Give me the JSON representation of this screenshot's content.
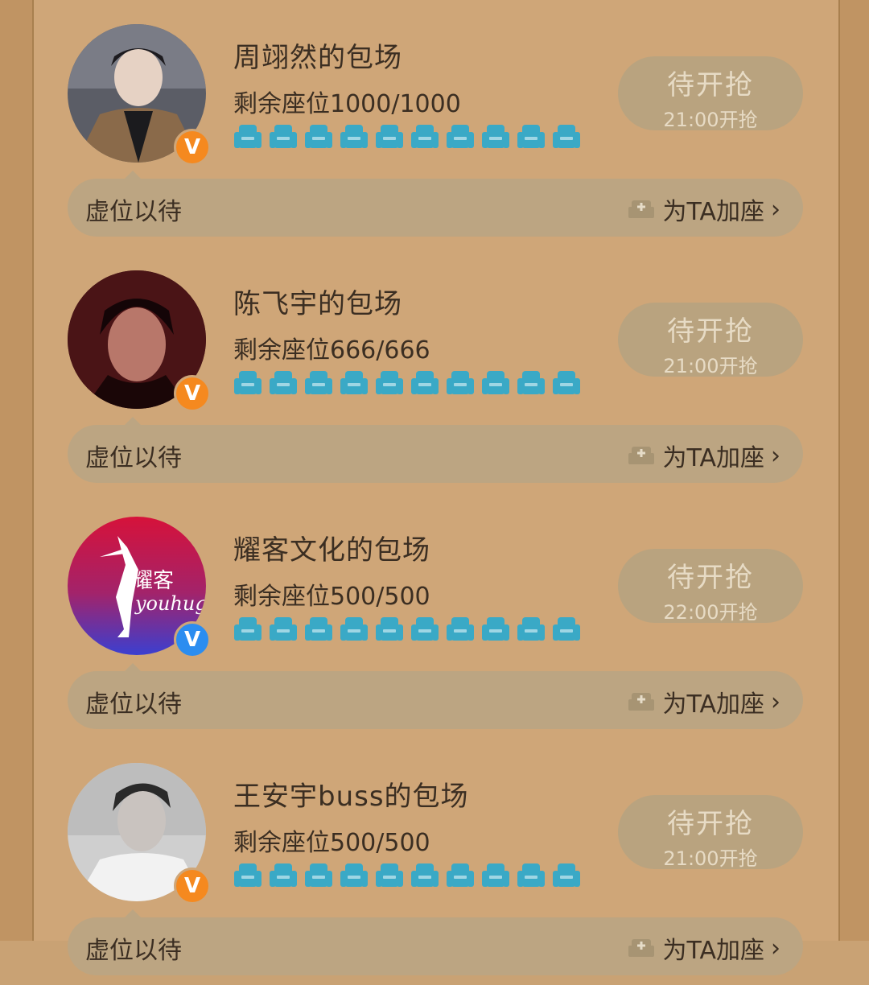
{
  "cards": [
    {
      "title": "周翊然的包场",
      "seats": "剩余座位1000/1000",
      "button_main": "待开抢",
      "button_sub": "21:00开抢",
      "bar_left": "虚位以待",
      "bar_right": "为TA加座",
      "badge": "V",
      "badge_color": "#f5891f"
    },
    {
      "title": "陈飞宇的包场",
      "seats": "剩余座位666/666",
      "button_main": "待开抢",
      "button_sub": "21:00开抢",
      "bar_left": "虚位以待",
      "bar_right": "为TA加座",
      "badge": "V",
      "badge_color": "#f5891f"
    },
    {
      "title": "耀客文化的包场",
      "seats": "剩余座位500/500",
      "button_main": "待开抢",
      "button_sub": "22:00开抢",
      "bar_left": "虚位以待",
      "bar_right": "为TA加座",
      "badge": "V",
      "badge_color": "#2b8df0",
      "logo_text_1": "耀客",
      "logo_text_2": "youhug"
    },
    {
      "title": "王安宇buss的包场",
      "seats": "剩余座位500/500",
      "button_main": "待开抢",
      "button_sub": "21:00开抢",
      "bar_left": "虚位以待",
      "bar_right": "为TA加座",
      "badge": "V",
      "badge_color": "#f5891f"
    }
  ],
  "colors": {
    "background": "#cfa678",
    "seat_icon": "#3aa9c6",
    "button_bg": "#b9a37f",
    "bar_bg": "#bca582"
  },
  "icons": {
    "seat": "armchair-icon",
    "add_seat": "add-seat-icon",
    "chevron": "chevron-right-icon",
    "verified": "verified-v-icon"
  }
}
